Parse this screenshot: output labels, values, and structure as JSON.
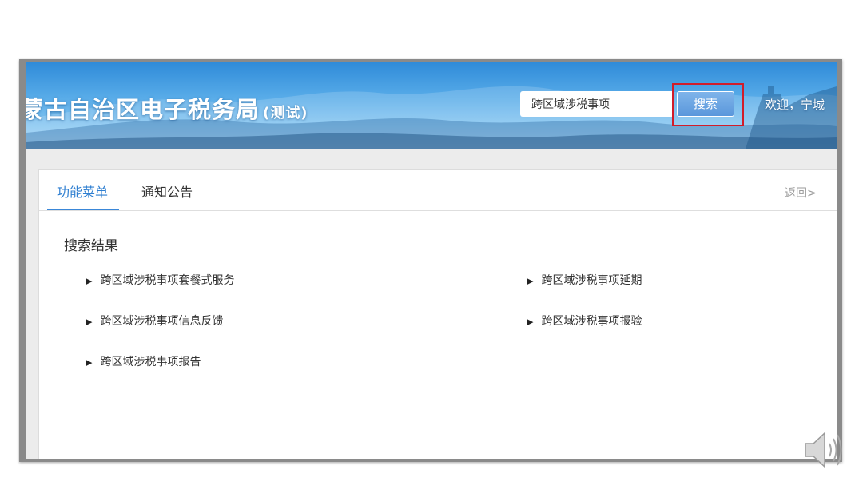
{
  "header": {
    "site_title": "蒙古自治区电子税务局",
    "site_subtitle": "(测试)",
    "search_value": "跨区域涉税事项",
    "search_button": "搜索",
    "welcome_text": "欢迎，宁城"
  },
  "tabs": [
    {
      "label": "功能菜单",
      "active": true
    },
    {
      "label": "通知公告",
      "active": false
    }
  ],
  "back_link": "返回>",
  "results": {
    "title": "搜索结果",
    "items": [
      {
        "label": "跨区域涉税事项套餐式服务"
      },
      {
        "label": "跨区域涉税事项延期"
      },
      {
        "label": "跨区域涉税事项信息反馈"
      },
      {
        "label": "跨区域涉税事项报验"
      },
      {
        "label": "跨区域涉税事项报告"
      }
    ]
  },
  "icons": {
    "result_marker": "▶",
    "speaker": "speaker-icon"
  },
  "colors": {
    "accent": "#2f7fd1",
    "highlight": "#d21c2a",
    "banner": "#4a9fe3"
  }
}
